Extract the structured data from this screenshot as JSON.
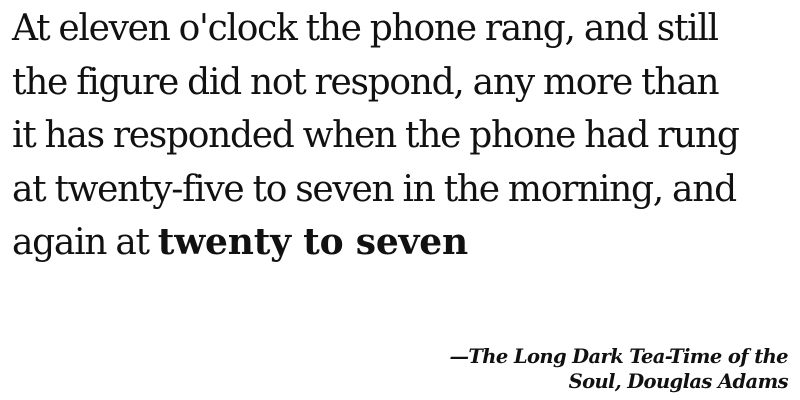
{
  "quote": {
    "lines": [
      "At eleven o'clock the phone rang, and still",
      "the figure did not respond, any more than",
      "it has responded when the phone had rung",
      "at twenty-five to seven in the morning, and"
    ],
    "last_line_prefix": "again at ",
    "emphasis": "twenty to seven"
  },
  "attribution": {
    "line1": "—The Long Dark Tea-Time of the",
    "line2": "Soul, Douglas Adams"
  }
}
